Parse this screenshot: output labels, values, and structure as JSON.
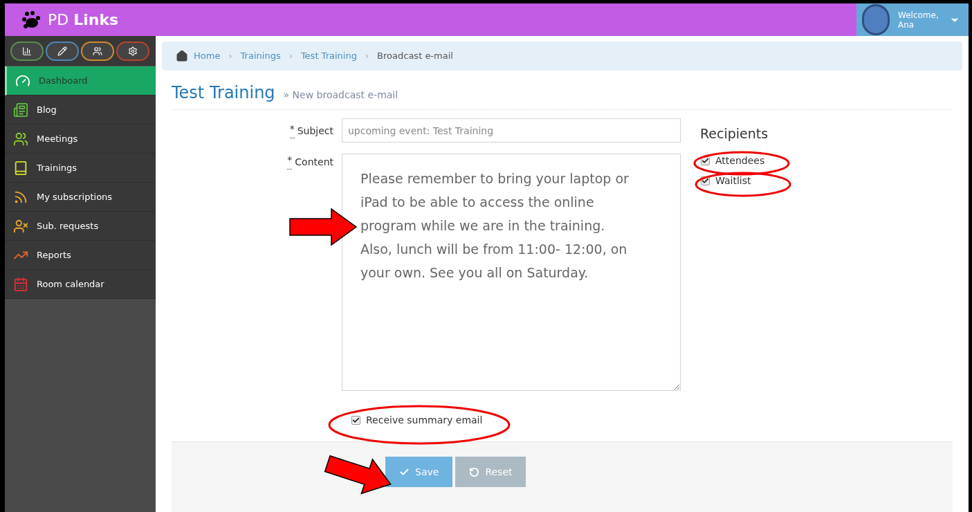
{
  "header": {
    "logo": "PD **Links**",
    "welcome": "Welcome,",
    "user": "Ana"
  },
  "toolbar_buttons": [
    {
      "color": "#5b8f4e"
    },
    {
      "color": "#4f86b8"
    },
    {
      "color": "#d08b2e"
    },
    {
      "color": "#b9432f"
    }
  ],
  "sidebar": {
    "items": [
      {
        "label": "Dashboard",
        "selected": true
      },
      {
        "label": "Blog",
        "selected": false
      },
      {
        "label": "Meetings",
        "selected": false
      },
      {
        "label": "Trainings",
        "selected": false
      },
      {
        "label": "My subscriptions",
        "selected": false
      },
      {
        "label": "Sub. requests",
        "selected": false
      },
      {
        "label": "Reports",
        "selected": false
      },
      {
        "label": "Room calendar",
        "selected": false
      }
    ]
  },
  "breadcrumb": [
    {
      "label": "Home",
      "current": false
    },
    {
      "label": "Trainings",
      "current": false
    },
    {
      "label": "Test Training",
      "current": false
    },
    {
      "label": "Broadcast e-mail",
      "current": true
    }
  ],
  "breadcrumb_separator": "›",
  "page_title": "Test Training",
  "page_subtitle": "» New broadcast e-mail",
  "form": {
    "subject": {
      "required_mark": "*",
      "label": "Subject",
      "value": "upcoming event: Test Training"
    },
    "content": {
      "required_mark": "*",
      "label": "Content",
      "value": "Please remember to bring your laptop or\niPad to be able to access the online\nprogram while we are in the training.\nAlso, lunch will be from 11:00- 12:00, on\nyour own. See you all on Saturday."
    },
    "receive_summary": {
      "label": "Receive summary email",
      "checked": true
    }
  },
  "recipients": {
    "title": "Recipients",
    "options": [
      {
        "label": "Attendees",
        "checked": true
      },
      {
        "label": "Waitlist",
        "checked": true
      }
    ]
  },
  "buttons": [
    {
      "label": "Save",
      "kind": "primary"
    },
    {
      "label": "Reset",
      "kind": "secondary"
    }
  ]
}
